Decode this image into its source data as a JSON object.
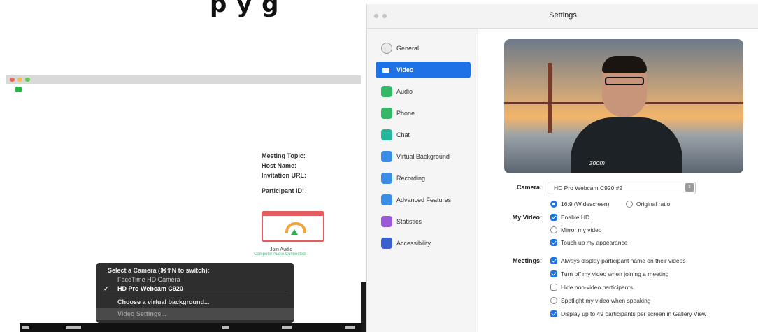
{
  "heading": {
    "text": "p       y         g"
  },
  "meeting": {
    "info_labels": [
      "Meeting Topic:",
      "Host Name:",
      "Invitation URL:",
      "Participant ID:"
    ],
    "join_audio": "Join Audio",
    "join_audio_sub": "Computer Audio Connected"
  },
  "camera_menu": {
    "header": "Select a Camera (⌘⇧N to switch):",
    "items": [
      "FaceTime HD Camera",
      "HD Pro Webcam C920"
    ],
    "checkmark": "✓",
    "virtual_bg": "Choose a virtual background...",
    "video_settings": "Video Settings..."
  },
  "settings": {
    "title": "Settings",
    "nav": [
      {
        "label": "General",
        "icon": "gear-icon",
        "color": "#e9e9e9",
        "active": false
      },
      {
        "label": "Video",
        "icon": "video-camera-icon",
        "color": "#1f72e6",
        "active": true
      },
      {
        "label": "Audio",
        "icon": "headphones-icon",
        "color": "#35b768",
        "active": false
      },
      {
        "label": "Phone",
        "icon": "phone-icon",
        "color": "#35b768",
        "active": false
      },
      {
        "label": "Chat",
        "icon": "chat-bubble-icon",
        "color": "#24b59a",
        "active": false
      },
      {
        "label": "Virtual Background",
        "icon": "virtual-background-icon",
        "color": "#3a8ee6",
        "active": false
      },
      {
        "label": "Recording",
        "icon": "recording-icon",
        "color": "#3a8ee6",
        "active": false
      },
      {
        "label": "Advanced Features",
        "icon": "advanced-features-icon",
        "color": "#3a8ee6",
        "active": false
      },
      {
        "label": "Statistics",
        "icon": "statistics-icon",
        "color": "#9b59d6",
        "active": false
      },
      {
        "label": "Accessibility",
        "icon": "accessibility-icon",
        "color": "#3a5fcf",
        "active": false
      }
    ],
    "camera_label": "Camera:",
    "camera_value": "HD Pro Webcam C920 #2",
    "my_video_label": "My Video:",
    "ratio_169": "16:9 (Widescreen)",
    "ratio_original": "Original ratio",
    "enable_hd": "Enable HD",
    "mirror": "Mirror my video",
    "touch_up": "Touch up my appearance",
    "meetings_label": "Meetings:",
    "meeting_opts": [
      {
        "label": "Always display participant name on their videos",
        "checked": true
      },
      {
        "label": "Turn off my video when joining a meeting",
        "checked": true
      },
      {
        "label": "Hide non-video participants",
        "checked": false
      },
      {
        "label": "Spotlight my video when speaking",
        "checked": false
      },
      {
        "label": "Display up to 49 participants per screen in Gallery View",
        "checked": true
      }
    ],
    "preview_logo": "zoom"
  },
  "colors": {
    "accent": "#1f72e6",
    "menu_bg": "#2e2e2e"
  }
}
